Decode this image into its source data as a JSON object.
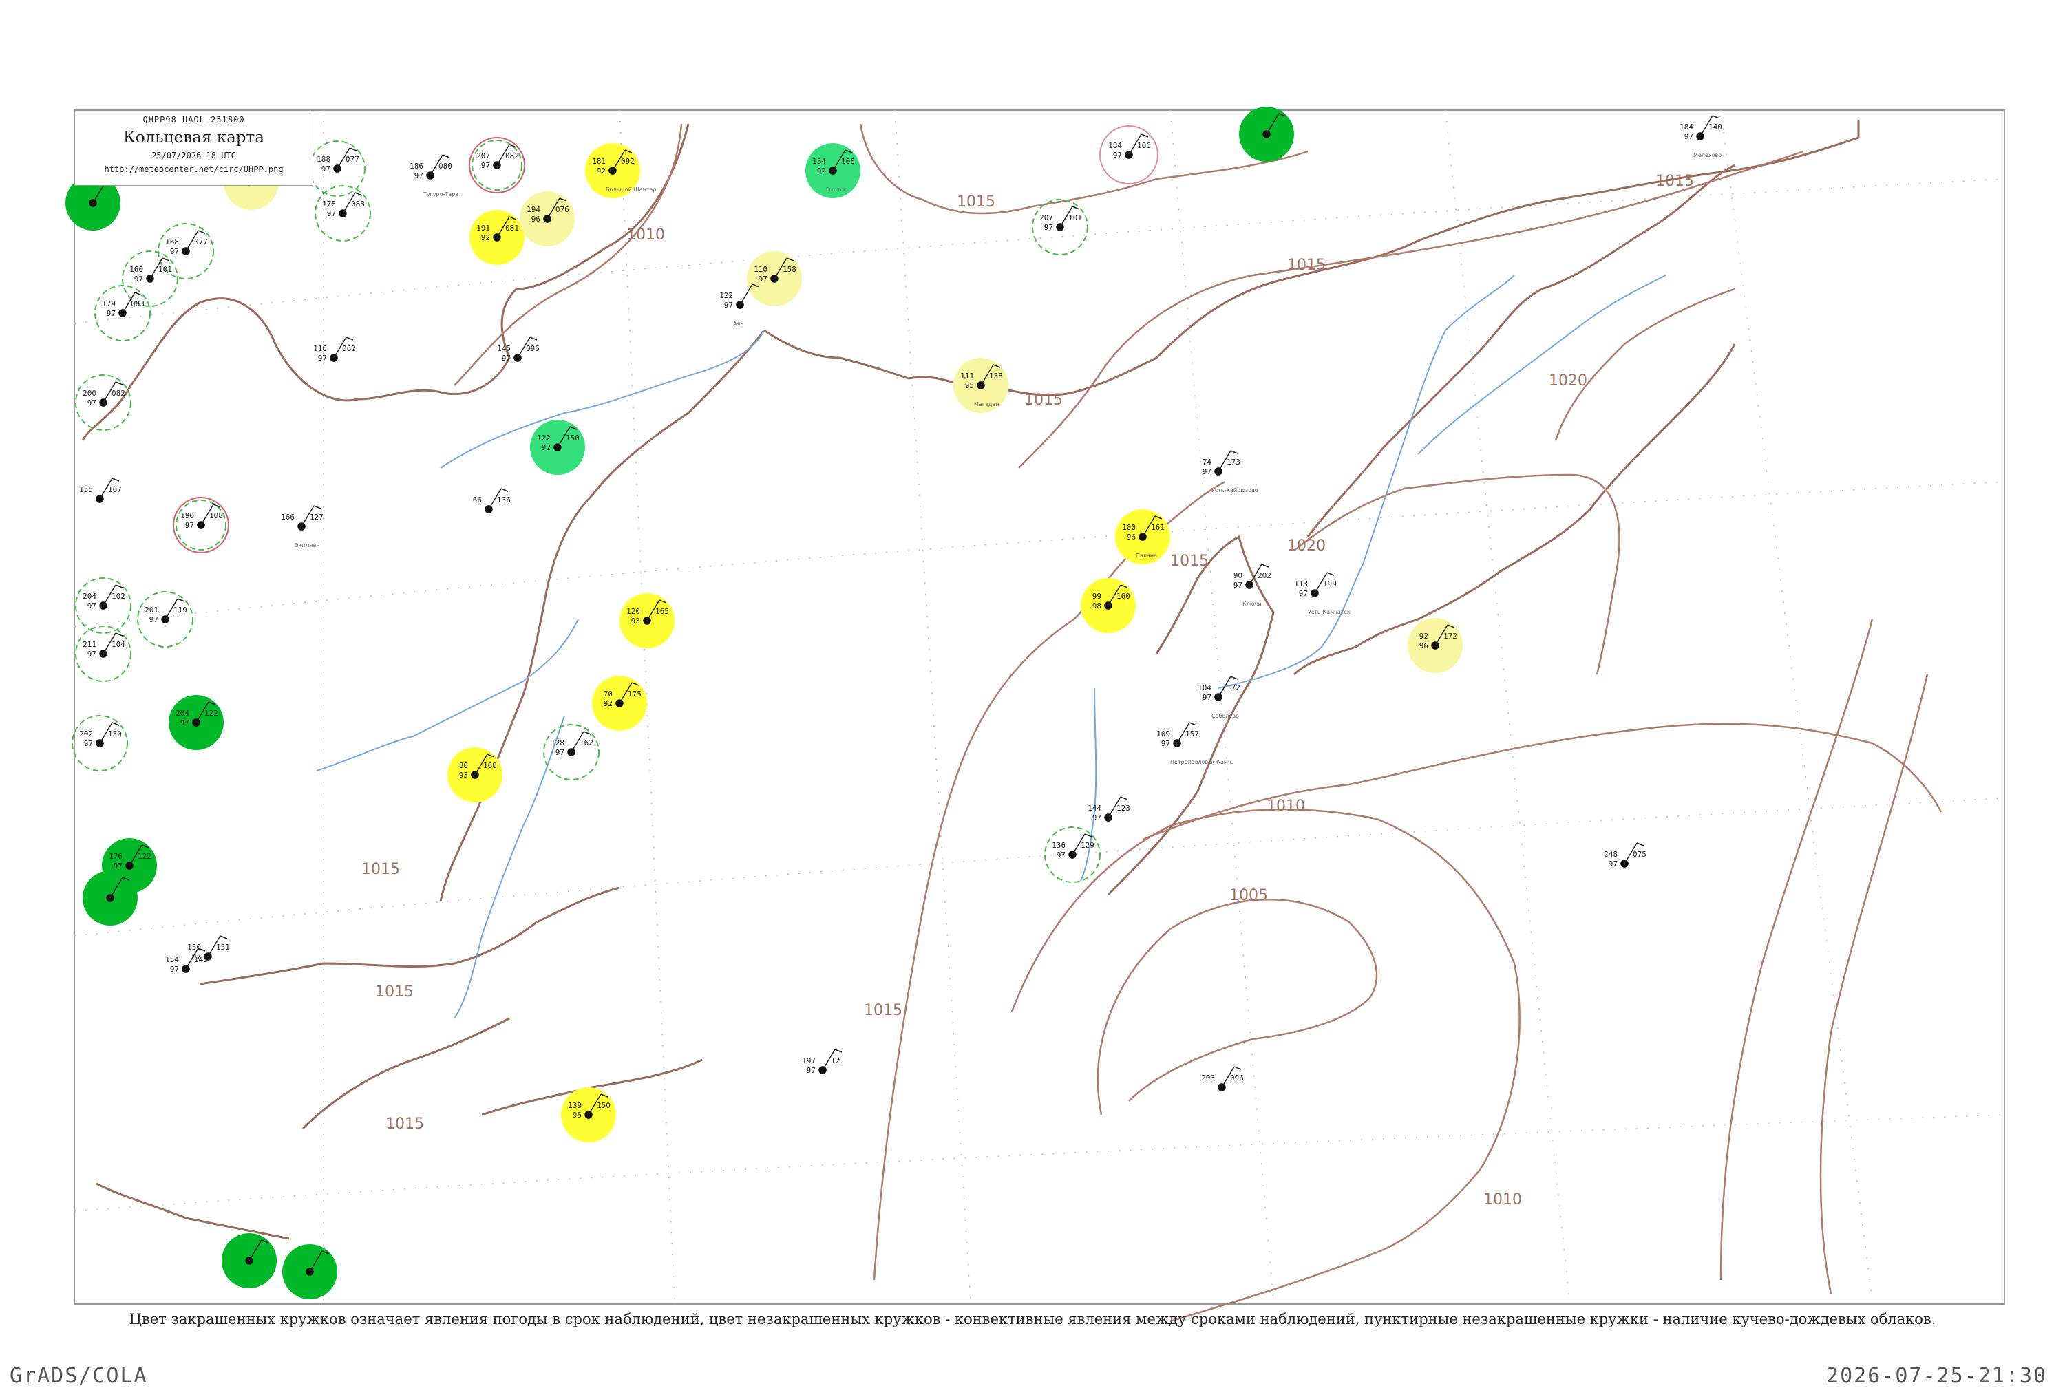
{
  "header": {
    "code": "QHPP98  UAOL  251800",
    "title": "Кольцевая карта",
    "time": "25/07/2026 18 UTC",
    "url": "http://meteocenter.net/circ/UHPP.png"
  },
  "caption": "Цвет закрашенных кружков означает явления погоды в срок наблюдений, цвет незакрашенных кружков - конвективные явления между сроками наблюдений, пунктирные незакрашенные кружки - наличие кучево-дождевых облаков.",
  "footer": {
    "left": "GrADS/COLA",
    "right": "2026-07-25-21:30"
  },
  "map": {
    "isobar_labels": [
      "1010",
      "1015",
      "1015",
      "1015",
      "1015",
      "1015",
      "1015",
      "1015",
      "1015",
      "1015",
      "1010",
      "1005",
      "1010",
      "1020",
      "1020"
    ],
    "colors": {
      "heavy_rain": "#00b828",
      "showers": "#33e07a",
      "thunder": "#ffff33",
      "light": "#f8f6a0",
      "cb_circle": "#44bb44",
      "red_ring": "#d06070",
      "pink_ring": "#e08aa0"
    },
    "stations": [
      {
        "kind": "heavy",
        "t": "",
        "p": "",
        "d": "",
        "name": ""
      },
      {
        "kind": "light",
        "t": "",
        "p": "",
        "d": "",
        "name": ""
      },
      {
        "kind": "cb",
        "t": "188",
        "p": "077",
        "d": "97",
        "name": ""
      },
      {
        "kind": "cb",
        "t": "178",
        "p": "088",
        "d": "97",
        "name": ""
      },
      {
        "kind": "cb",
        "t": "168",
        "p": "077",
        "d": "97",
        "name": ""
      },
      {
        "kind": "cb",
        "t": "160",
        "p": "101",
        "d": "97",
        "name": ""
      },
      {
        "kind": "cb",
        "t": "179",
        "p": "083",
        "d": "97",
        "name": ""
      },
      {
        "kind": "plain",
        "t": "186",
        "p": "080",
        "d": "97",
        "name": "Тугуро-Тарат"
      },
      {
        "kind": "red",
        "t": "207",
        "p": "082",
        "d": "97",
        "name": ""
      },
      {
        "kind": "thunder",
        "t": "191",
        "p": "081",
        "d": "92",
        "name": ""
      },
      {
        "kind": "light",
        "t": "194",
        "p": "076",
        "d": "96",
        "name": ""
      },
      {
        "kind": "thunder",
        "t": "181",
        "p": "092",
        "d": "92",
        "name": "Большой Шантар"
      },
      {
        "kind": "showers",
        "t": "154",
        "p": "106",
        "d": "92",
        "name": "Охотск"
      },
      {
        "kind": "pink",
        "t": "184",
        "p": "106",
        "d": "97",
        "name": ""
      },
      {
        "kind": "heavy",
        "t": "",
        "p": "",
        "d": "",
        "name": ""
      },
      {
        "kind": "plain",
        "t": "184",
        "p": "140",
        "d": "97",
        "name": "Мелехово"
      },
      {
        "kind": "cb",
        "t": "207",
        "p": "101",
        "d": "97",
        "name": ""
      },
      {
        "kind": "light",
        "t": "110",
        "p": "158",
        "d": "97",
        "name": ""
      },
      {
        "kind": "plain",
        "t": "122",
        "p": "",
        "d": "97",
        "name": "Аян"
      },
      {
        "kind": "light",
        "t": "111",
        "p": "158",
        "d": "95",
        "name": "Магадан"
      },
      {
        "kind": "plain",
        "t": "145",
        "p": "096",
        "d": "97",
        "name": ""
      },
      {
        "kind": "plain",
        "t": "116",
        "p": "062",
        "d": "97",
        "name": ""
      },
      {
        "kind": "cb",
        "t": "200",
        "p": "082",
        "d": "97",
        "name": ""
      },
      {
        "kind": "showers",
        "t": "122",
        "p": "150",
        "d": "92",
        "name": ""
      },
      {
        "kind": "plain",
        "t": "155",
        "p": "107",
        "d": "",
        "name": ""
      },
      {
        "kind": "red",
        "t": "190",
        "p": "108",
        "d": "97",
        "name": ""
      },
      {
        "kind": "plain",
        "t": "166",
        "p": "127",
        "d": "",
        "name": "Экимчан"
      },
      {
        "kind": "plain",
        "t": "66",
        "p": "136",
        "d": "",
        "name": ""
      },
      {
        "kind": "plain",
        "t": "74",
        "p": "173",
        "d": "97",
        "name": "Усть-Хайрюзово"
      },
      {
        "kind": "thunder",
        "t": "100",
        "p": "161",
        "d": "96",
        "name": "Палана"
      },
      {
        "kind": "thunder",
        "t": "99",
        "p": "160",
        "d": "98",
        "name": ""
      },
      {
        "kind": "plain",
        "t": "90",
        "p": "202",
        "d": "97",
        "name": "Ключи"
      },
      {
        "kind": "plain",
        "t": "113",
        "p": "199",
        "d": "97",
        "name": "Усть-Камчатск"
      },
      {
        "kind": "light",
        "t": "92",
        "p": "172",
        "d": "96",
        "name": ""
      },
      {
        "kind": "thunder",
        "t": "120",
        "p": "165",
        "d": "93",
        "name": ""
      },
      {
        "kind": "thunder",
        "t": "70",
        "p": "175",
        "d": "92",
        "name": ""
      },
      {
        "kind": "cb",
        "t": "204",
        "p": "102",
        "d": "97",
        "name": ""
      },
      {
        "kind": "cb",
        "t": "201",
        "p": "119",
        "d": "97",
        "name": ""
      },
      {
        "kind": "cb",
        "t": "211",
        "p": "104",
        "d": "97",
        "name": ""
      },
      {
        "kind": "heavy",
        "t": "204",
        "p": "122",
        "d": "97",
        "name": ""
      },
      {
        "kind": "cb",
        "t": "202",
        "p": "150",
        "d": "97",
        "name": ""
      },
      {
        "kind": "thunder",
        "t": "80",
        "p": "168",
        "d": "93",
        "name": ""
      },
      {
        "kind": "cb",
        "t": "128",
        "p": "162",
        "d": "97",
        "name": ""
      },
      {
        "kind": "plain",
        "t": "104",
        "p": "172",
        "d": "97",
        "name": "Соболево"
      },
      {
        "kind": "plain",
        "t": "109",
        "p": "157",
        "d": "97",
        "name": "Петропавловск-Камч."
      },
      {
        "kind": "cb",
        "t": "136",
        "p": "129",
        "d": "97",
        "name": ""
      },
      {
        "kind": "plain",
        "t": "144",
        "p": "123",
        "d": "97",
        "name": ""
      },
      {
        "kind": "heavy",
        "t": "176",
        "p": "122",
        "d": "97",
        "name": ""
      },
      {
        "kind": "heavy",
        "t": "",
        "p": "",
        "d": "",
        "name": ""
      },
      {
        "kind": "plain",
        "t": "150",
        "p": "151",
        "d": "97",
        "name": ""
      },
      {
        "kind": "plain",
        "t": "154",
        "p": "148",
        "d": "97",
        "name": ""
      },
      {
        "kind": "thunder",
        "t": "139",
        "p": "150",
        "d": "95",
        "name": ""
      },
      {
        "kind": "plain",
        "t": "197",
        "p": "12",
        "d": "97",
        "name": ""
      },
      {
        "kind": "plain",
        "t": "203",
        "p": "096",
        "d": "",
        "name": ""
      },
      {
        "kind": "plain",
        "t": "248",
        "p": "075",
        "d": "97",
        "name": ""
      },
      {
        "kind": "heavy",
        "t": "",
        "p": "",
        "d": "",
        "name": ""
      },
      {
        "kind": "heavy",
        "t": "",
        "p": "",
        "d": "",
        "name": ""
      }
    ]
  }
}
